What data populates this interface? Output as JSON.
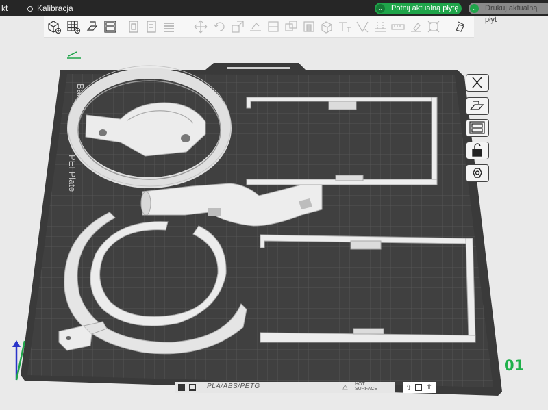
{
  "topbar": {
    "project_tab": "kt",
    "calibration_tab": "Kalibracja",
    "slice_button": "Potnij aktualną płytę",
    "print_button": "Drukuj aktualną płyt"
  },
  "toolbar": {
    "icons": [
      "add-cube-icon",
      "grid-icon",
      "auto-orient-icon",
      "arrange-icon",
      "copy-icon",
      "paste-icon",
      "list-icon",
      "move-icon",
      "rotate-icon",
      "scale-icon",
      "lay-flat-icon",
      "cut-icon",
      "split-objects-icon",
      "split-parts-icon",
      "boolean-icon",
      "support-icon",
      "text-icon",
      "seam-icon",
      "measure-icon",
      "paint-icon",
      "assembly-icon",
      "layers-icon"
    ]
  },
  "plate": {
    "brand_text": "Bam",
    "plate_type_text": "PEI Plate",
    "filament_text": "PLA/ABS/PETG",
    "hot_surface_text": "HOT SURFACE",
    "plate_number": "01"
  },
  "side_tools": [
    "close-icon",
    "auto-arrange-icon",
    "plate-settings-icon",
    "lock-icon",
    "hex-settings-icon"
  ]
}
